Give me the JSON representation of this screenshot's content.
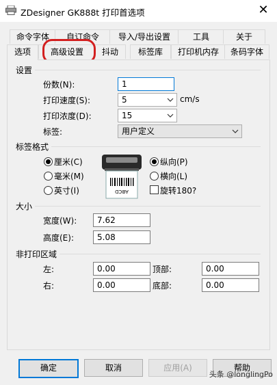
{
  "window": {
    "title": "ZDesigner GK888t 打印首选项",
    "close_glyph": "✕"
  },
  "tabs_back": [
    {
      "label": "命令字体"
    },
    {
      "label": "自订命令"
    },
    {
      "label": "导入/导出设置"
    },
    {
      "label": "工具"
    },
    {
      "label": "关于"
    }
  ],
  "tabs_front": [
    {
      "label": "选项"
    },
    {
      "label": "高级设置"
    },
    {
      "label": "抖动"
    },
    {
      "label": "标签库"
    },
    {
      "label": "打印机内存"
    },
    {
      "label": "条码字体"
    }
  ],
  "settings": {
    "heading": "设置",
    "copies_label": "份数(N):",
    "copies_value": "1",
    "speed_label": "打印速度(S):",
    "speed_value": "5",
    "speed_unit": "cm/s",
    "darkness_label": "打印浓度(D):",
    "darkness_value": "15",
    "stock_label": "标签:",
    "stock_value": "用户定义"
  },
  "format": {
    "heading": "标签格式",
    "units": [
      {
        "label": "厘米(C)",
        "selected": true
      },
      {
        "label": "毫米(M)",
        "selected": false
      },
      {
        "label": "英寸(I)",
        "selected": false
      }
    ],
    "orientation": [
      {
        "label": "纵向(P)",
        "selected": true
      },
      {
        "label": "横向(L)",
        "selected": false
      }
    ],
    "rotate_label": "旋转180?",
    "rotate_checked": false,
    "preview_text": "ABCD"
  },
  "size": {
    "heading": "大小",
    "width_label": "宽度(W):",
    "width_value": "7.62",
    "height_label": "高度(E):",
    "height_value": "5.08"
  },
  "unprintable": {
    "heading": "非打印区域",
    "left_label": "左:",
    "left_value": "0.00",
    "top_label": "顶部:",
    "top_value": "0.00",
    "right_label": "右:",
    "right_value": "0.00",
    "bottom_label": "底部:",
    "bottom_value": "0.00"
  },
  "buttons": {
    "ok": "确定",
    "cancel": "取消",
    "apply": "应用(A)",
    "help": "帮助"
  },
  "watermark": "头条 @longlingPo",
  "colors": {
    "highlight": "#d32020",
    "focus": "#0078d7",
    "dialog_bg": "#f0f0f0"
  }
}
